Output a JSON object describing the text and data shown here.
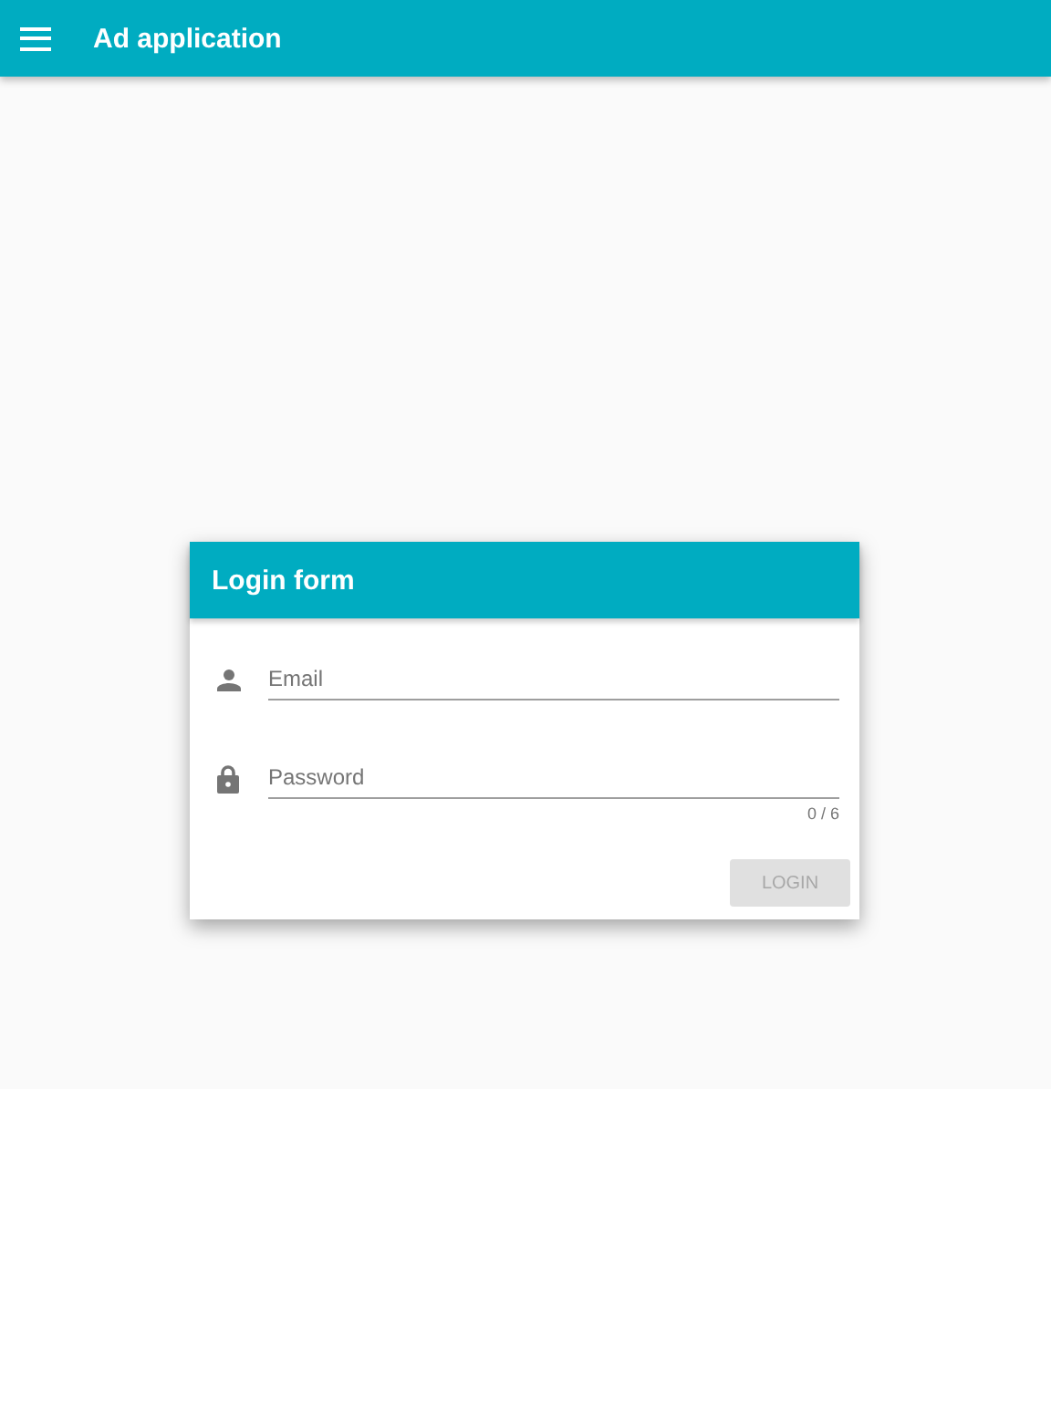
{
  "app_bar": {
    "title": "Ad application"
  },
  "login_card": {
    "title": "Login form",
    "fields": [
      {
        "kind": "email",
        "placeholder": "Email"
      },
      {
        "kind": "password",
        "placeholder": "Password",
        "counter": "0 / 6"
      }
    ],
    "login_button": {
      "label": "LOGIN",
      "disabled": true
    }
  }
}
